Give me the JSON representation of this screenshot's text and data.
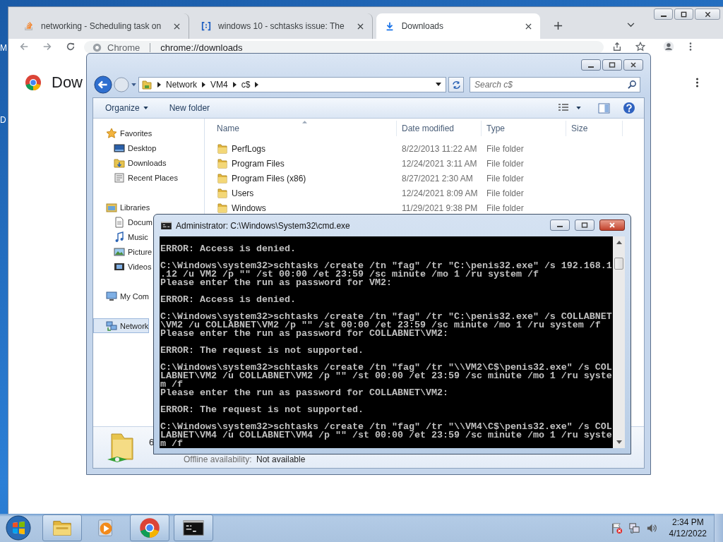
{
  "desktop": {
    "icon_labels": [
      "M",
      "D"
    ]
  },
  "browser": {
    "tabs": [
      {
        "title": "networking - Scheduling task on",
        "kind": "stack",
        "selected": false
      },
      {
        "title": "windows 10 - schtasks issue: The",
        "kind": "bracket",
        "selected": false
      },
      {
        "title": "Downloads",
        "kind": "download",
        "selected": true
      }
    ],
    "omnibox": {
      "site_label": "Chrome",
      "url": "chrome://downloads"
    },
    "page_title": "Dow"
  },
  "explorer": {
    "breadcrumb": [
      "Network",
      "VM4",
      "c$"
    ],
    "search": {
      "placeholder": "Search c$"
    },
    "toolbar": [
      {
        "label": "Organize",
        "menu": true
      },
      {
        "label": "New folder",
        "menu": false
      }
    ],
    "nav": [
      {
        "label": "Favorites",
        "kind": "star",
        "selected": false,
        "children": [
          {
            "label": "Desktop",
            "kind": "desktop",
            "selected": false
          },
          {
            "label": "Downloads",
            "kind": "downloads",
            "selected": false
          },
          {
            "label": "Recent Places",
            "kind": "recent",
            "selected": false
          }
        ]
      },
      {
        "label": "Libraries",
        "kind": "library",
        "selected": false,
        "children": [
          {
            "label": "Docum",
            "kind": "document",
            "selected": false
          },
          {
            "label": "Music",
            "kind": "music",
            "selected": false
          },
          {
            "label": "Picture",
            "kind": "picture",
            "selected": false
          },
          {
            "label": "Videos",
            "kind": "video",
            "selected": false
          }
        ]
      },
      {
        "label": "My Com",
        "kind": "computer",
        "selected": false
      },
      {
        "label": "Network",
        "kind": "network",
        "selected": true
      }
    ],
    "columns": [
      "Name",
      "Date modified",
      "Type",
      "Size"
    ],
    "rows": [
      {
        "name": "PerfLogs",
        "date": "8/22/2013 11:22 AM",
        "type": "File folder"
      },
      {
        "name": "Program Files",
        "date": "12/24/2021 3:11 AM",
        "type": "File folder"
      },
      {
        "name": "Program Files (x86)",
        "date": "8/27/2021 2:30 AM",
        "type": "File folder"
      },
      {
        "name": "Users",
        "date": "12/24/2021 8:09 AM",
        "type": "File folder"
      },
      {
        "name": "Windows",
        "date": "11/29/2021 9:38 PM",
        "type": "File folder"
      }
    ],
    "details": {
      "count": "6",
      "offline_label": "Offline availability:",
      "offline_value": "Not available"
    }
  },
  "console": {
    "title": "Administrator: C:\\Windows\\System32\\cmd.exe",
    "blocks": [
      [
        "ERROR: Access is denied."
      ],
      [
        "C:\\Windows\\system32>schtasks /create /tn \"fag\" /tr \"C:\\penis32.exe\" /s 192.168.1",
        ".12 /u VM2 /p \"\" /st 00:00 /et 23:59 /sc minute /mo 1 /ru system /f",
        "Please enter the run as password for VM2:"
      ],
      [
        "ERROR: Access is denied."
      ],
      [
        "C:\\Windows\\system32>schtasks /create /tn \"fag\" /tr \"C:\\penis32.exe\" /s COLLABNET",
        "\\VM2 /u COLLABNET\\VM2 /p \"\" /st 00:00 /et 23:59 /sc minute /mo 1 /ru system /f",
        "Please enter the run as password for COLLABNET\\VM2:"
      ],
      [
        "ERROR: The request is not supported."
      ],
      [
        "C:\\Windows\\system32>schtasks /create /tn \"fag\" /tr \"\\\\VM2\\C$\\penis32.exe\" /s COL",
        "LABNET\\VM2 /u COLLABNET\\VM2 /p \"\" /st 00:00 /et 23:59 /sc minute /mo 1 /ru syste",
        "m /f",
        "Please enter the run as password for COLLABNET\\VM2:"
      ],
      [
        "ERROR: The request is not supported."
      ],
      [
        "C:\\Windows\\system32>schtasks /create /tn \"fag\" /tr \"\\\\VM4\\C$\\penis32.exe\" /s COL",
        "LABNET\\VM4 /u COLLABNET\\VM4 /p \"\" /st 00:00 /et 23:59 /sc minute /mo 1 /ru syste",
        "m /f"
      ]
    ]
  },
  "taskbar": {
    "apps": [
      {
        "kind": "explorer",
        "running": true
      },
      {
        "kind": "media",
        "running": false
      },
      {
        "kind": "chrome",
        "running": true
      },
      {
        "kind": "console",
        "running": true
      }
    ],
    "time": "2:34 PM",
    "date": "4/12/2022"
  }
}
